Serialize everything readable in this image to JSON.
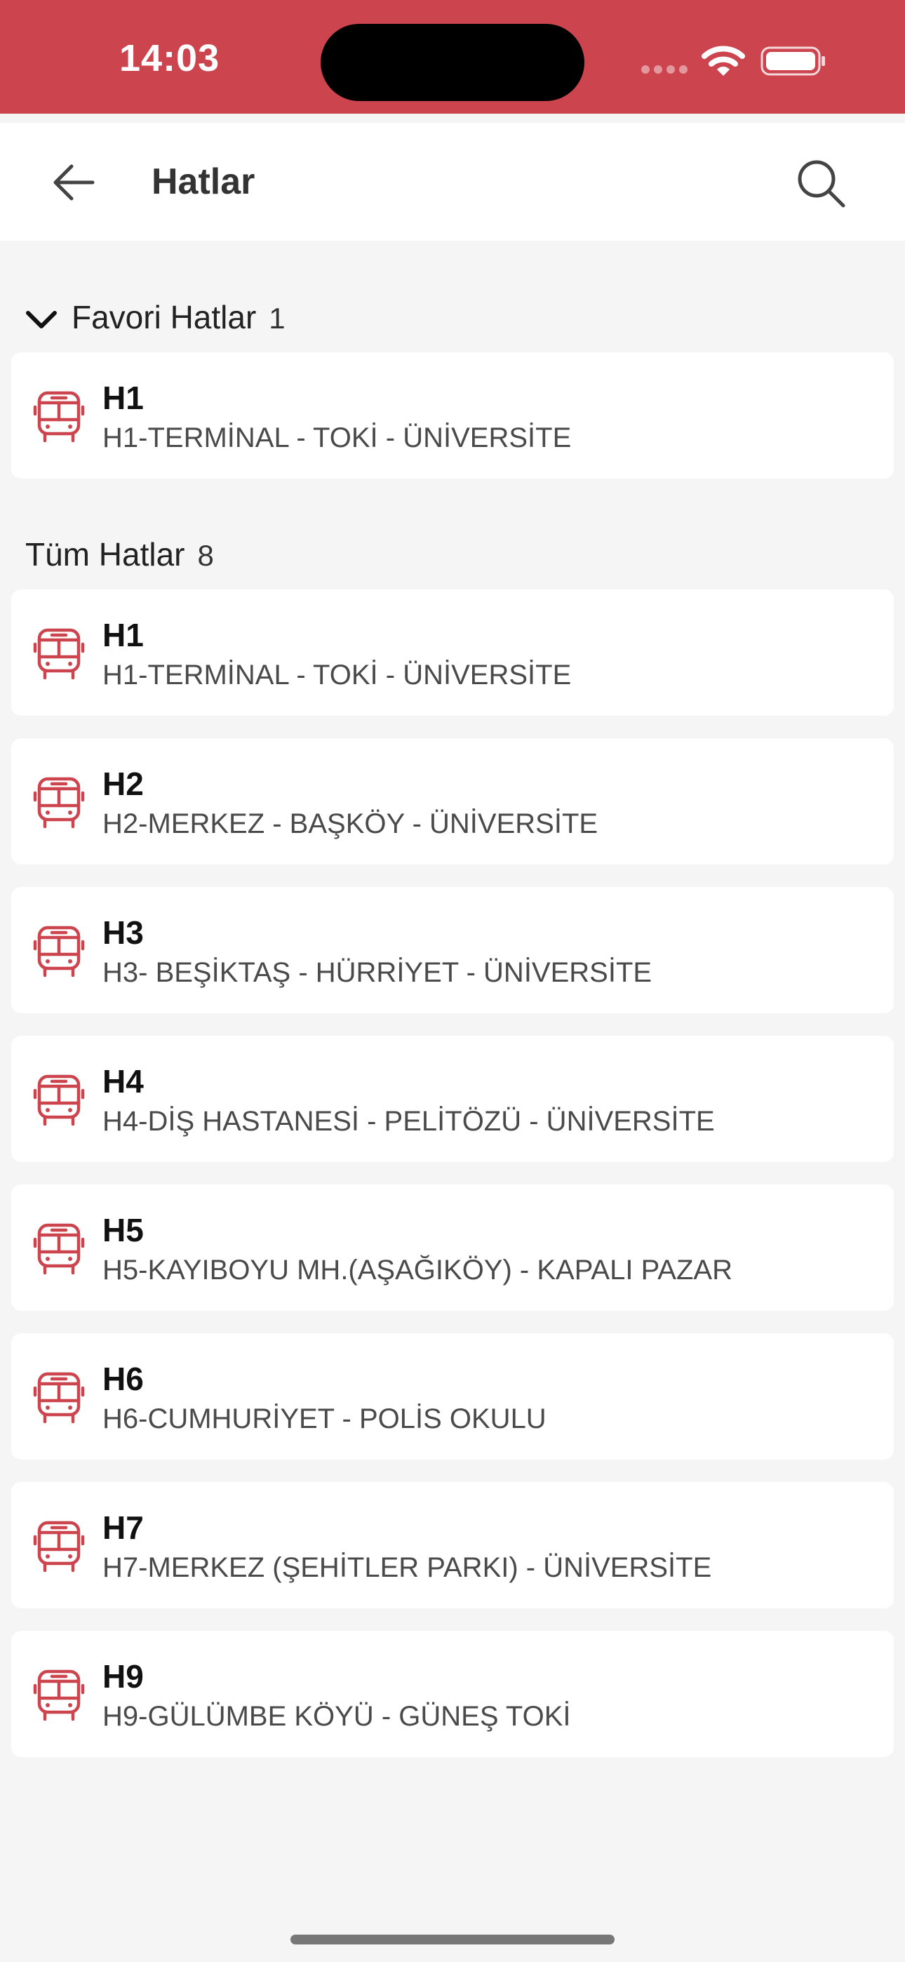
{
  "status_bar": {
    "time": "14:03",
    "bg_color": "#cc444d"
  },
  "header": {
    "title": "Hatlar",
    "back_icon": "arrow-left-icon",
    "search_icon": "search-icon"
  },
  "favorites": {
    "title": "Favori Hatlar",
    "count": "1",
    "items": [
      {
        "code": "H1",
        "route": "H1-TERMİNAL - TOKİ - ÜNİVERSİTE"
      }
    ]
  },
  "all_lines": {
    "title": "Tüm Hatlar",
    "count": "8",
    "items": [
      {
        "code": "H1",
        "route": "H1-TERMİNAL - TOKİ - ÜNİVERSİTE"
      },
      {
        "code": "H2",
        "route": "H2-MERKEZ - BAŞKÖY - ÜNİVERSİTE"
      },
      {
        "code": "H3",
        "route": "H3- BEŞİKTAŞ - HÜRRİYET - ÜNİVERSİTE"
      },
      {
        "code": "H4",
        "route": "H4-DİŞ HASTANESİ - PELİTÖZÜ - ÜNİVERSİTE"
      },
      {
        "code": "H5",
        "route": "H5-KAYIBOYU MH.(AŞAĞIKÖY) - KAPALI PAZAR"
      },
      {
        "code": "H6",
        "route": "H6-CUMHURİYET - POLİS OKULU"
      },
      {
        "code": "H7",
        "route": "H7-MERKEZ (ŞEHİTLER PARKI) - ÜNİVERSİTE"
      },
      {
        "code": "H9",
        "route": "H9-GÜLÜMBE KÖYÜ - GÜNEŞ TOKİ"
      }
    ]
  },
  "colors": {
    "accent": "#cc444d",
    "card_bg": "#ffffff",
    "page_bg": "#f5f5f5"
  },
  "item_icon": "bus-icon"
}
